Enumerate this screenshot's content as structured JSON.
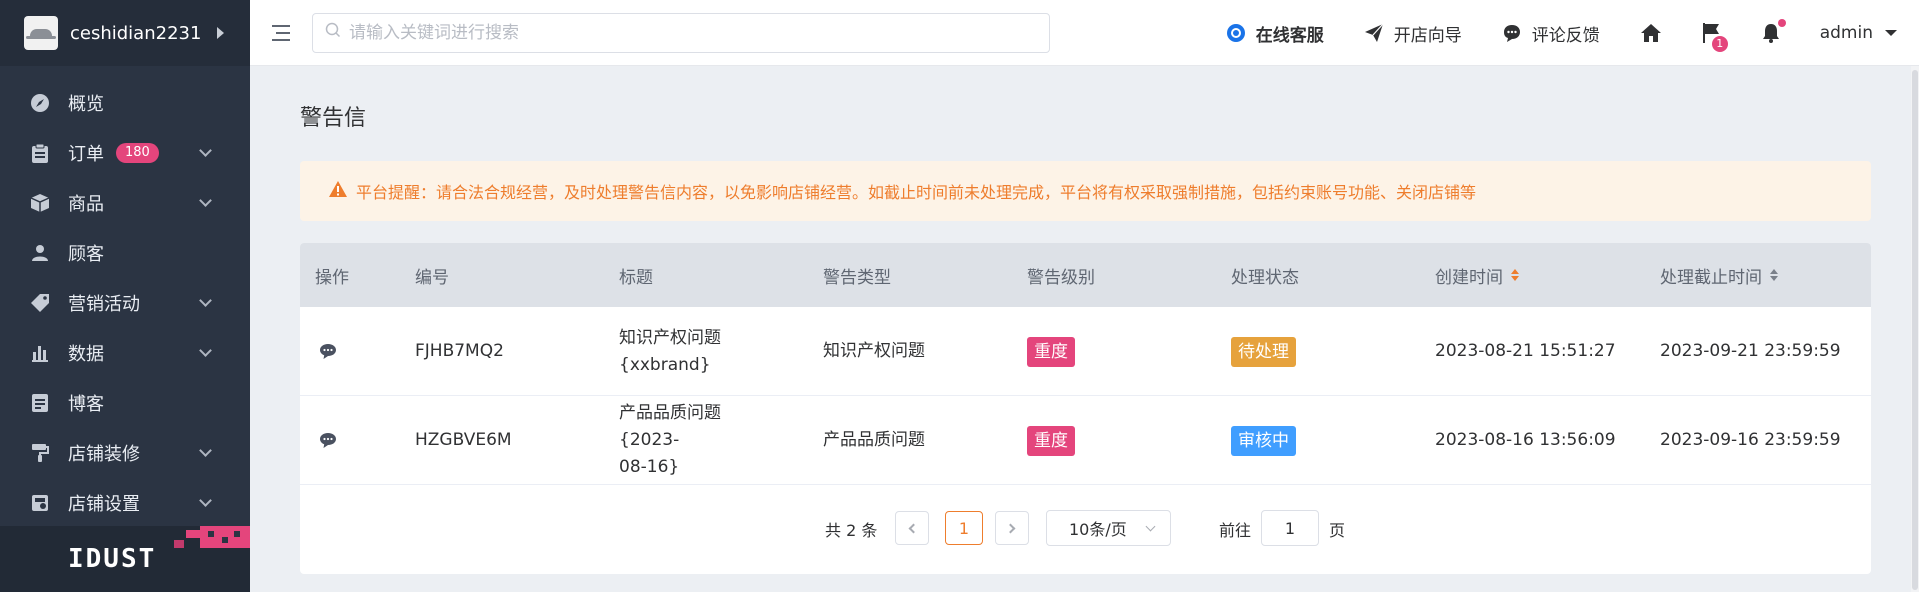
{
  "brand": {
    "name": "ceshidian2231"
  },
  "sidebar": {
    "items": [
      {
        "label": "概览",
        "icon": "compass-icon",
        "badge": null,
        "expandable": false
      },
      {
        "label": "订单",
        "icon": "clipboard-icon",
        "badge": "180",
        "expandable": true
      },
      {
        "label": "商品",
        "icon": "box-icon",
        "badge": null,
        "expandable": true
      },
      {
        "label": "顾客",
        "icon": "user-icon",
        "badge": null,
        "expandable": false
      },
      {
        "label": "营销活动",
        "icon": "tag-icon",
        "badge": null,
        "expandable": true
      },
      {
        "label": "数据",
        "icon": "bar-chart-icon",
        "badge": null,
        "expandable": true
      },
      {
        "label": "博客",
        "icon": "document-icon",
        "badge": null,
        "expandable": false
      },
      {
        "label": "店铺装修",
        "icon": "paint-roller-icon",
        "badge": null,
        "expandable": true
      },
      {
        "label": "店铺设置",
        "icon": "store-settings-icon",
        "badge": null,
        "expandable": true
      }
    ],
    "footer_logo_text": "IDUST"
  },
  "header": {
    "search_placeholder": "请输入关键词进行搜索",
    "online_service": "在线客服",
    "store_guide": "开店向导",
    "feedback": "评论反馈",
    "flag_badge": "1",
    "user": "admin"
  },
  "page": {
    "title": "警告信",
    "alert": "平台提醒：请合法合规经营，及时处理警告信内容，以免影响店铺经营。如截止时间前未处理完成，平台将有权采取强制措施，包括约束账号功能、关闭店铺等"
  },
  "table": {
    "columns": [
      "操作",
      "编号",
      "标题",
      "警告类型",
      "警告级别",
      "处理状态",
      "创建时间",
      "处理截止时间"
    ],
    "rows": [
      {
        "id": "FJHB7MQ2",
        "title_line1": "知识产权问题",
        "title_line2": "{xxbrand}",
        "type": "知识产权问题",
        "level": "重度",
        "status": "待处理",
        "created": "2023-08-21 15:51:27",
        "deadline": "2023-09-21 23:59:59"
      },
      {
        "id": "HZGBVE6M",
        "title_line1": "产品品质问题{2023-",
        "title_line2": "08-16}",
        "type": "产品品质问题",
        "level": "重度",
        "status": "审核中",
        "created": "2023-08-16 13:56:09",
        "deadline": "2023-09-16 23:59:59"
      }
    ]
  },
  "pagination": {
    "total_text": "共 2 条",
    "current_page": "1",
    "page_size": "10条/页",
    "goto_label": "前往",
    "goto_value": "1",
    "goto_suffix": "页"
  },
  "colors": {
    "sidebar_bg": "#2b3443",
    "accent": "#ee7d2d",
    "badge_pink": "#e4457c",
    "tag_severe": "#e4457c",
    "status_pending": "#e6a23c",
    "status_review": "#409eff",
    "alert_bg": "#fdf3e7"
  }
}
